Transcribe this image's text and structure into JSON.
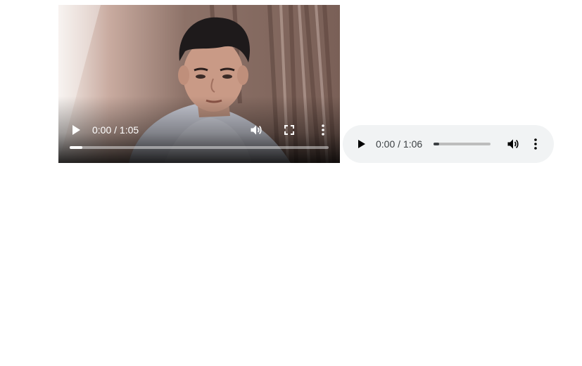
{
  "video_player": {
    "current_time": "0:00",
    "duration": "1:05",
    "time_label": "0:00 / 1:05",
    "progress_fraction": 0.05,
    "icons": {
      "play": "play-icon",
      "volume": "volume-icon",
      "fullscreen": "fullscreen-icon",
      "more": "more-options-icon"
    }
  },
  "audio_player": {
    "current_time": "0:00",
    "duration": "1:06",
    "time_label": "0:00 / 1:06",
    "progress_fraction": 0.1,
    "icons": {
      "play": "play-icon",
      "volume": "volume-icon",
      "more": "more-options-icon"
    }
  },
  "colors": {
    "audio_background": "#f1f3f4",
    "audio_text": "#3c4043",
    "video_controls": "#ffffff"
  }
}
